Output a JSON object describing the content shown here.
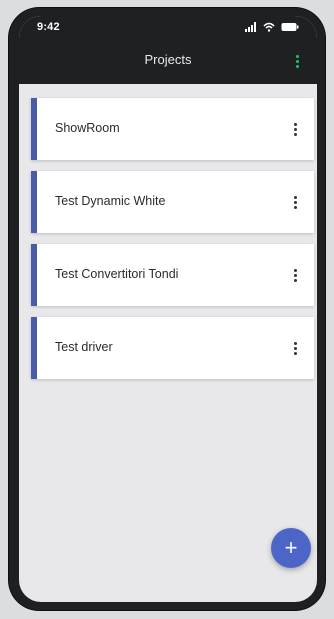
{
  "statusbar": {
    "time": "9:42",
    "icons": [
      "signal-icon",
      "wifi-icon",
      "battery-icon"
    ]
  },
  "appbar": {
    "title": "Projects",
    "menu_icon": "vertical-ellipsis-icon"
  },
  "projects": [
    {
      "name": "ShowRoom"
    },
    {
      "name": "Test Dynamic White"
    },
    {
      "name": "Test Convertitori Tondi"
    },
    {
      "name": "Test driver"
    }
  ],
  "fab": {
    "icon": "plus-icon",
    "label": "+"
  },
  "colors": {
    "appbar_bg": "#1f2022",
    "card_accent": "#4a5ba8",
    "fab": "#4e65c8",
    "menu_accent": "#20c46a"
  }
}
